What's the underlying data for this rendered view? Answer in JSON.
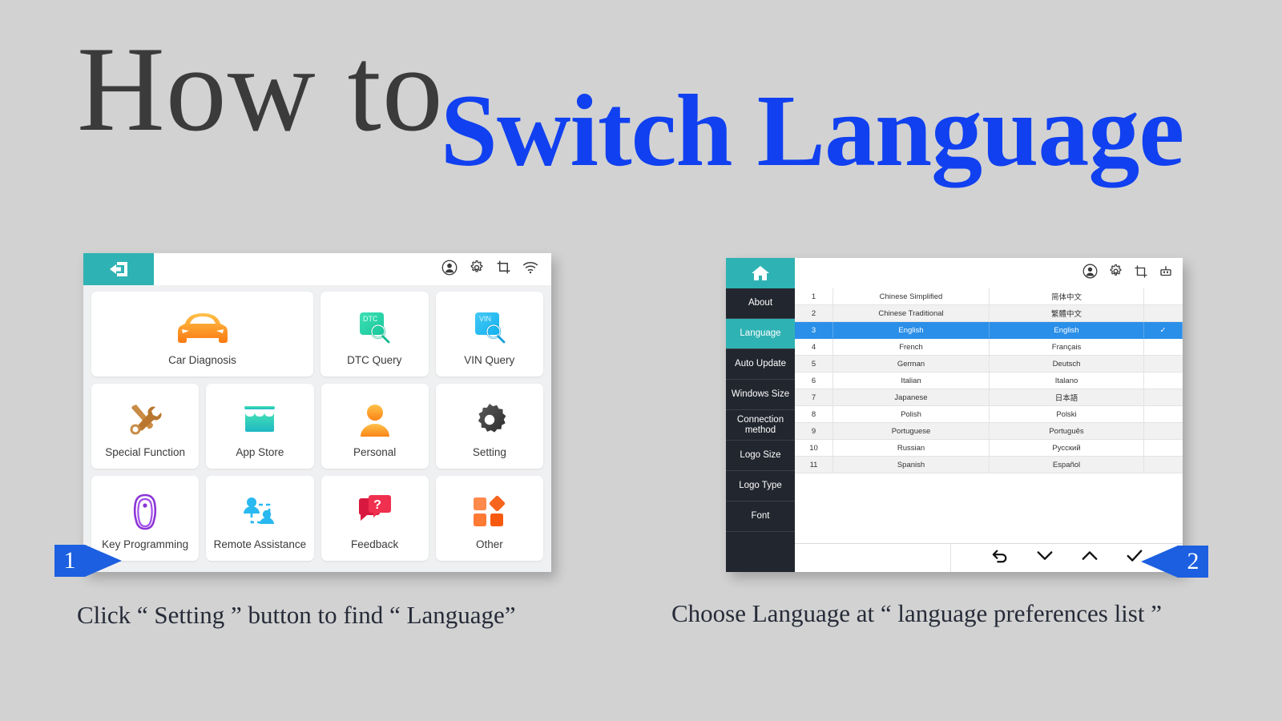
{
  "title": {
    "line1": "How to",
    "line2": "Switch Language",
    "color_primary": "#3b3b3b",
    "color_accent": "#1040f0"
  },
  "colors": {
    "background": "#d2d2d2",
    "teal": "#2fb2b4",
    "sidebar_dark": "#22262f",
    "selected_blue": "#2a8fe8",
    "marker_blue": "#1c5fe0"
  },
  "left_tablet": {
    "topbar": {
      "home_icon": "exit-back-icon",
      "status_icons": [
        "account-icon",
        "gear-icon",
        "crop-icon",
        "wifi-icon"
      ]
    },
    "tiles": [
      [
        {
          "label": "Car Diagnosis",
          "icon": "car-icon",
          "size": "wide"
        },
        {
          "label": "DTC Query",
          "icon": "dtc-search-icon",
          "size": "norm"
        },
        {
          "label": "VIN Query",
          "icon": "vin-search-icon",
          "size": "norm"
        }
      ],
      [
        {
          "label": "Special Function",
          "icon": "tools-icon",
          "size": "norm"
        },
        {
          "label": "App Store",
          "icon": "store-icon",
          "size": "norm"
        },
        {
          "label": "Personal",
          "icon": "person-icon",
          "size": "norm"
        },
        {
          "label": "Setting",
          "icon": "gear-icon",
          "size": "norm"
        }
      ],
      [
        {
          "label": "Key Programming",
          "icon": "key-fob-icon",
          "size": "norm"
        },
        {
          "label": "Remote Assistance",
          "icon": "remote-assist-icon",
          "size": "norm"
        },
        {
          "label": "Feedback",
          "icon": "feedback-bubble-icon",
          "size": "norm"
        },
        {
          "label": "Other",
          "icon": "grid-squares-icon",
          "size": "norm"
        }
      ]
    ]
  },
  "right_tablet": {
    "topbar": {
      "home_icon": "home-icon",
      "status_icons": [
        "account-icon",
        "gear-icon",
        "crop-icon",
        "usb-icon"
      ]
    },
    "sidebar": [
      {
        "label": "About",
        "active": false
      },
      {
        "label": "Language",
        "active": true
      },
      {
        "label": "Auto Update",
        "active": false
      },
      {
        "label": "Windows Size",
        "active": false
      },
      {
        "label": "Connection method",
        "active": false
      },
      {
        "label": "Logo Size",
        "active": false
      },
      {
        "label": "Logo Type",
        "active": false
      },
      {
        "label": "Font",
        "active": false
      }
    ],
    "languages": [
      {
        "index": "1",
        "english": "Chinese Simplified",
        "native": "简体中文",
        "selected": false,
        "check": ""
      },
      {
        "index": "2",
        "english": "Chinese Traditional",
        "native": "繁體中文",
        "selected": false,
        "check": ""
      },
      {
        "index": "3",
        "english": "English",
        "native": "English",
        "selected": true,
        "check": "✓"
      },
      {
        "index": "4",
        "english": "French",
        "native": "Français",
        "selected": false,
        "check": ""
      },
      {
        "index": "5",
        "english": "German",
        "native": "Deutsch",
        "selected": false,
        "check": ""
      },
      {
        "index": "6",
        "english": "Italian",
        "native": "Italano",
        "selected": false,
        "check": ""
      },
      {
        "index": "7",
        "english": "Japanese",
        "native": "日本語",
        "selected": false,
        "check": ""
      },
      {
        "index": "8",
        "english": "Polish",
        "native": "Polski",
        "selected": false,
        "check": ""
      },
      {
        "index": "9",
        "english": "Portuguese",
        "native": "Português",
        "selected": false,
        "check": ""
      },
      {
        "index": "10",
        "english": "Russian",
        "native": "Русский",
        "selected": false,
        "check": ""
      },
      {
        "index": "11",
        "english": "Spanish",
        "native": "Español",
        "selected": false,
        "check": ""
      }
    ],
    "bottom_nav": [
      "undo-icon",
      "chevron-down-icon",
      "chevron-up-icon",
      "check-icon"
    ]
  },
  "markers": [
    {
      "number": "1",
      "direction": "right"
    },
    {
      "number": "2",
      "direction": "left"
    }
  ],
  "captions": {
    "left": "Click “ Setting ” button to find “ Language”",
    "right": "Choose Language at “ language preferences list ”"
  }
}
